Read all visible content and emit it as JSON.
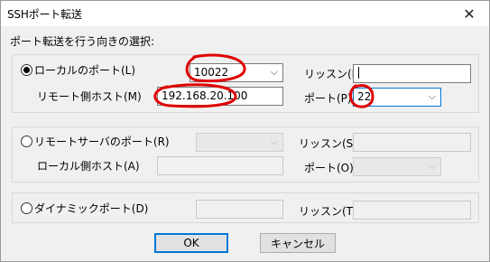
{
  "window": {
    "title": "SSHポート転送",
    "close_glyph": "✕"
  },
  "instruction": "ポート転送を行う向きの選択:",
  "local": {
    "radio_label": "ローカルのポート(L)",
    "port_value": "10022",
    "listen_label": "リッスン(I)",
    "listen_value": "",
    "remote_host_label": "リモート側ホスト(M)",
    "remote_host_value": "192.168.20.100",
    "remote_port_label": "ポート(P)",
    "remote_port_value": "22"
  },
  "remote": {
    "radio_label": "リモートサーバのポート(R)",
    "listen_label": "リッスン(S)",
    "local_host_label": "ローカル側ホスト(A)",
    "port_label": "ポート(O)"
  },
  "dynamic": {
    "radio_label": "ダイナミックポート(D)",
    "listen_label": "リッスン(T)"
  },
  "buttons": {
    "ok": "OK",
    "cancel": "キャンセル"
  },
  "icons": {
    "dropdown": "chevron-down-icon",
    "close": "close-icon"
  },
  "colors": {
    "annotation": "#e00000",
    "focus": "#0078d7"
  }
}
